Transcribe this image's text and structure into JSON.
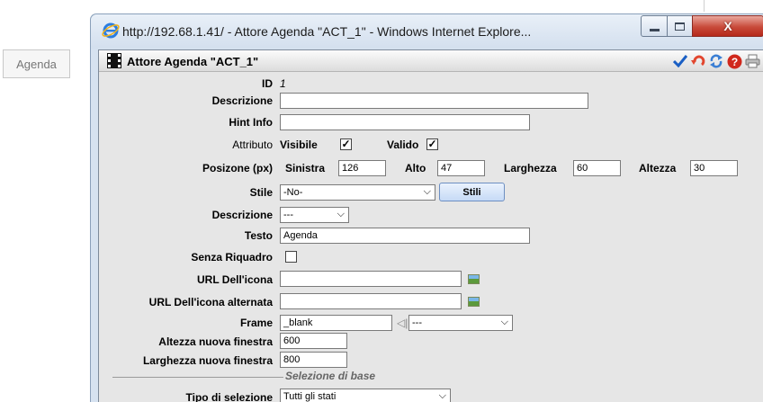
{
  "background": {
    "agenda_label": "Agenda"
  },
  "window": {
    "title": "http://192.68.1.41/ - Attore Agenda \"ACT_1\" - Windows Internet Explore...",
    "min_glyph": "—",
    "max_glyph": "□",
    "close_glyph": "X"
  },
  "panel": {
    "title": "Attore Agenda \"ACT_1\"",
    "toolbar_icons": [
      "checkmark-icon",
      "undo-icon",
      "refresh-icon",
      "help-icon",
      "print-icon"
    ]
  },
  "form": {
    "id": {
      "label": "ID",
      "value": "1"
    },
    "descrizione": {
      "label": "Descrizione",
      "value": ""
    },
    "hint_info": {
      "label": "Hint Info",
      "value": ""
    },
    "attributo": {
      "label": "Attributo",
      "visibile_label": "Visibile",
      "visibile_checked": true,
      "valido_label": "Valido",
      "valido_checked": true
    },
    "posizione": {
      "label": "Posizone (px)",
      "sinistra_label": "Sinistra",
      "sinistra": "126",
      "alto_label": "Alto",
      "alto": "47",
      "larghezza_label": "Larghezza",
      "larghezza": "60",
      "altezza_label": "Altezza",
      "altezza": "30"
    },
    "stile": {
      "label": "Stile",
      "value": "-No-",
      "button_label": "Stili"
    },
    "descrizione2": {
      "label": "Descrizione",
      "value": "---"
    },
    "testo": {
      "label": "Testo",
      "value": "Agenda"
    },
    "senza_riquadro": {
      "label": "Senza Riquadro",
      "checked": false
    },
    "url_icona": {
      "label": "URL Dell'icona",
      "value": ""
    },
    "url_icona_alt": {
      "label": "URL Dell'icona alternata",
      "value": ""
    },
    "frame": {
      "label": "Frame",
      "value": "_blank",
      "select_value": "---"
    },
    "altezza_finestra": {
      "label": "Altezza nuova finestra",
      "value": "600"
    },
    "larghezza_finestra": {
      "label": "Larghezza nuova finestra",
      "value": "800"
    },
    "section_title": "Selezione di base",
    "tipo_selezione": {
      "label": "Tipo di selezione",
      "value": "Tutti gli stati"
    }
  },
  "colors": {
    "accent_blue": "#1a5fc4",
    "close_red": "#c84a3a",
    "help_red": "#d0281c"
  }
}
